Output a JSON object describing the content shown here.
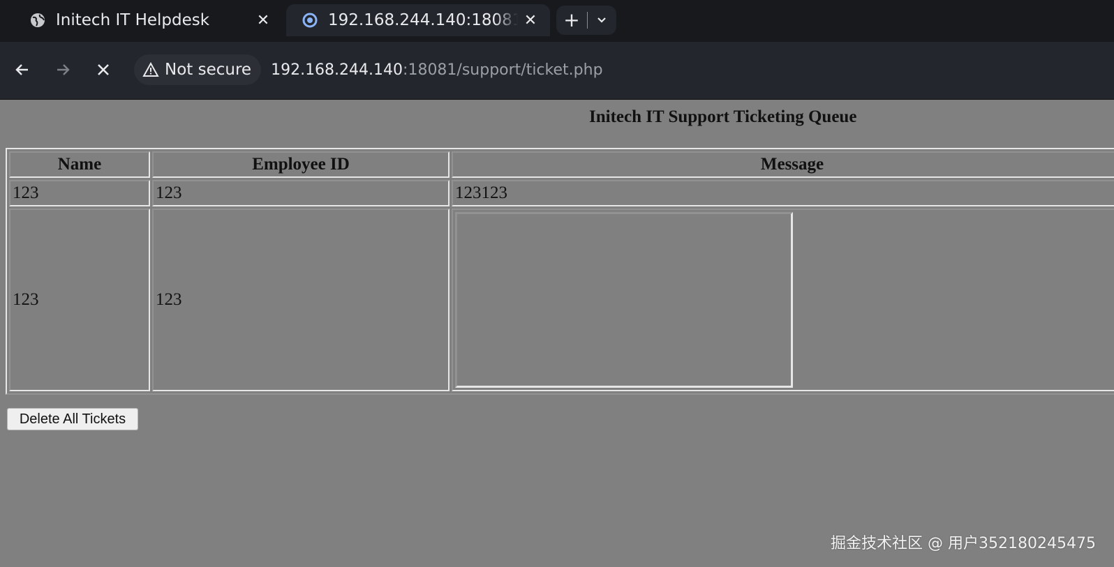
{
  "browser": {
    "tabs": [
      {
        "title": "Initech IT Helpdesk",
        "favicon": "globe-icon",
        "active": false
      },
      {
        "title": "192.168.244.140:18081/su",
        "favicon": "loading-spinner-icon",
        "active": true
      }
    ],
    "new_tab": "+",
    "security_label": "Not secure",
    "url_host": "192.168.244.140",
    "url_rest": ":18081/support/ticket.php"
  },
  "page": {
    "title": "Initech IT Support Ticketing Queue",
    "table": {
      "headers": [
        "Name",
        "Employee ID",
        "Message"
      ],
      "rows": [
        {
          "name": "123",
          "employee_id": "123",
          "message": "123123"
        },
        {
          "name": "123",
          "employee_id": "123",
          "message": ""
        }
      ]
    },
    "delete_button": "Delete All Tickets"
  },
  "watermark": "掘金技术社区 @ 用户352180245475",
  "colors": {
    "page_background": "#808080",
    "chrome_dark": "#17191d",
    "toolbar": "#23262c"
  }
}
